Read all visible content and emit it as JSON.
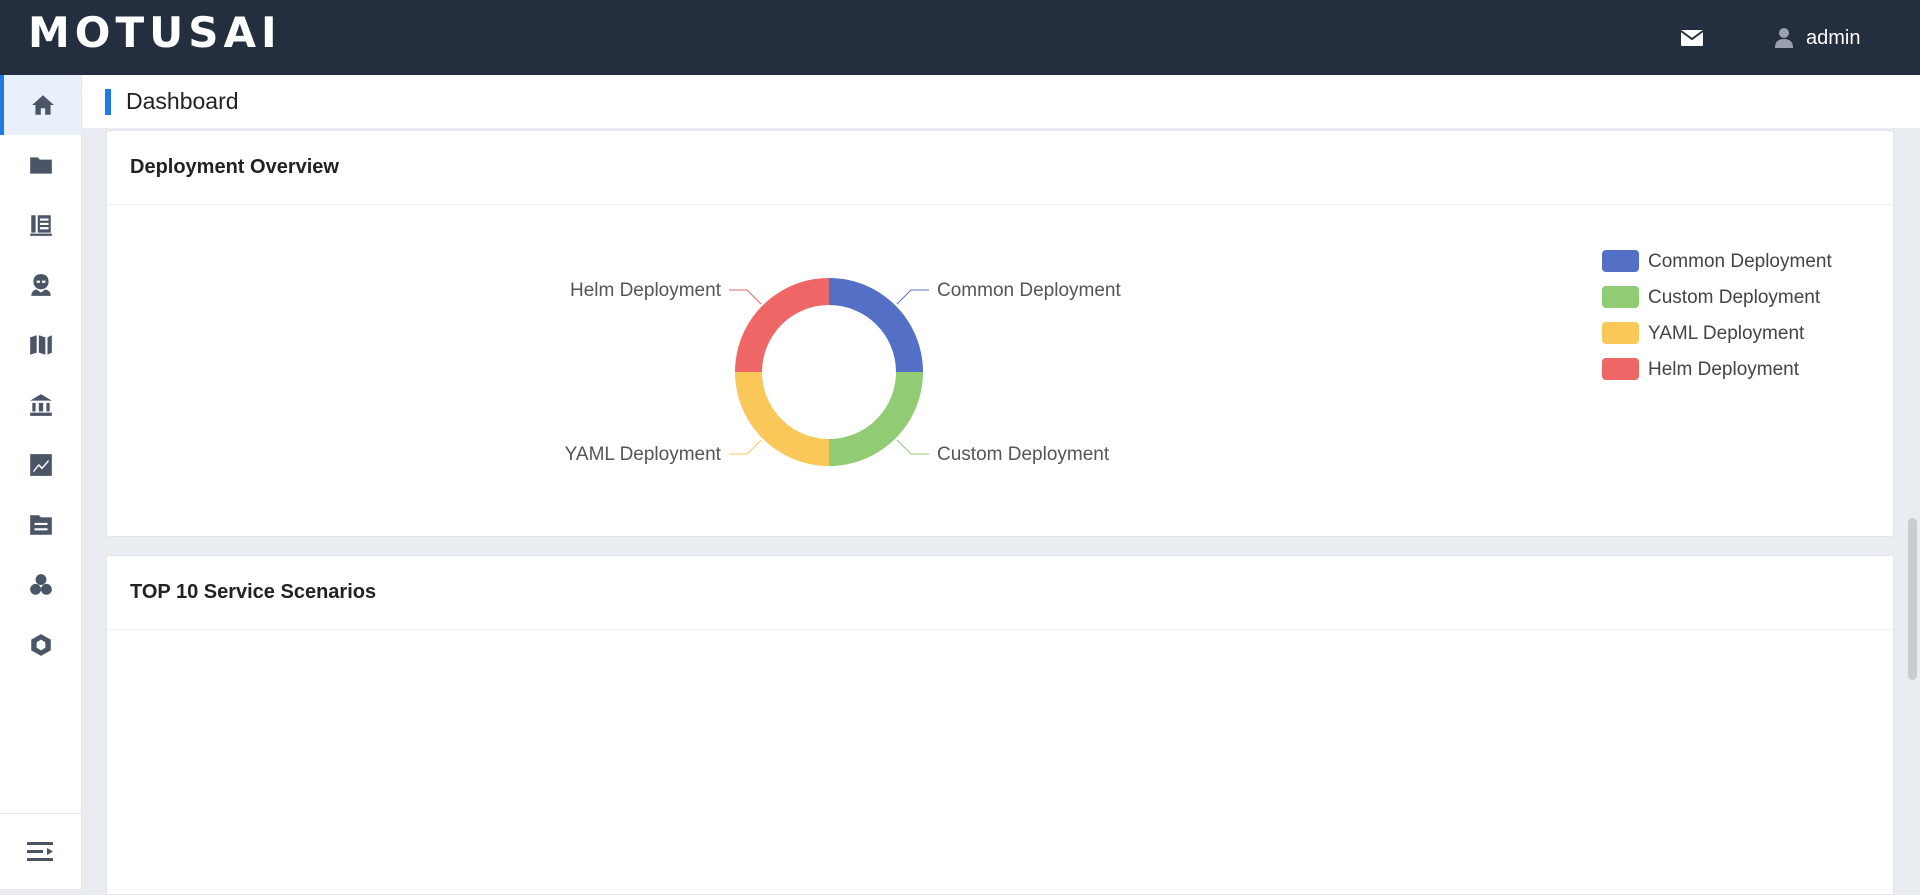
{
  "app": {
    "logo": "MOTUSAI"
  },
  "header": {
    "user_name": "admin"
  },
  "breadcrumb": {
    "title": "Dashboard"
  },
  "sidebar": {
    "items": [
      {
        "icon": "home-icon"
      },
      {
        "icon": "folder-icon"
      },
      {
        "icon": "book-icon"
      },
      {
        "icon": "agent-icon"
      },
      {
        "icon": "map-icon"
      },
      {
        "icon": "bank-icon"
      },
      {
        "icon": "chart-icon"
      },
      {
        "icon": "document-icon"
      },
      {
        "icon": "user-group-icon"
      },
      {
        "icon": "hexagon-icon"
      }
    ],
    "collapse_icon": "menu-collapse-icon"
  },
  "cards": {
    "deployment": {
      "title": "Deployment Overview"
    },
    "top10": {
      "title": "TOP 10 Service Scenarios"
    }
  },
  "chart_data": {
    "type": "pie",
    "categories": [
      "Common Deployment",
      "Custom Deployment",
      "YAML Deployment",
      "Helm Deployment"
    ],
    "values": [
      1,
      1,
      1,
      1
    ],
    "colors": [
      "#5470c6",
      "#91cc75",
      "#fac858",
      "#ee6666"
    ],
    "legend_position": "top-right"
  }
}
